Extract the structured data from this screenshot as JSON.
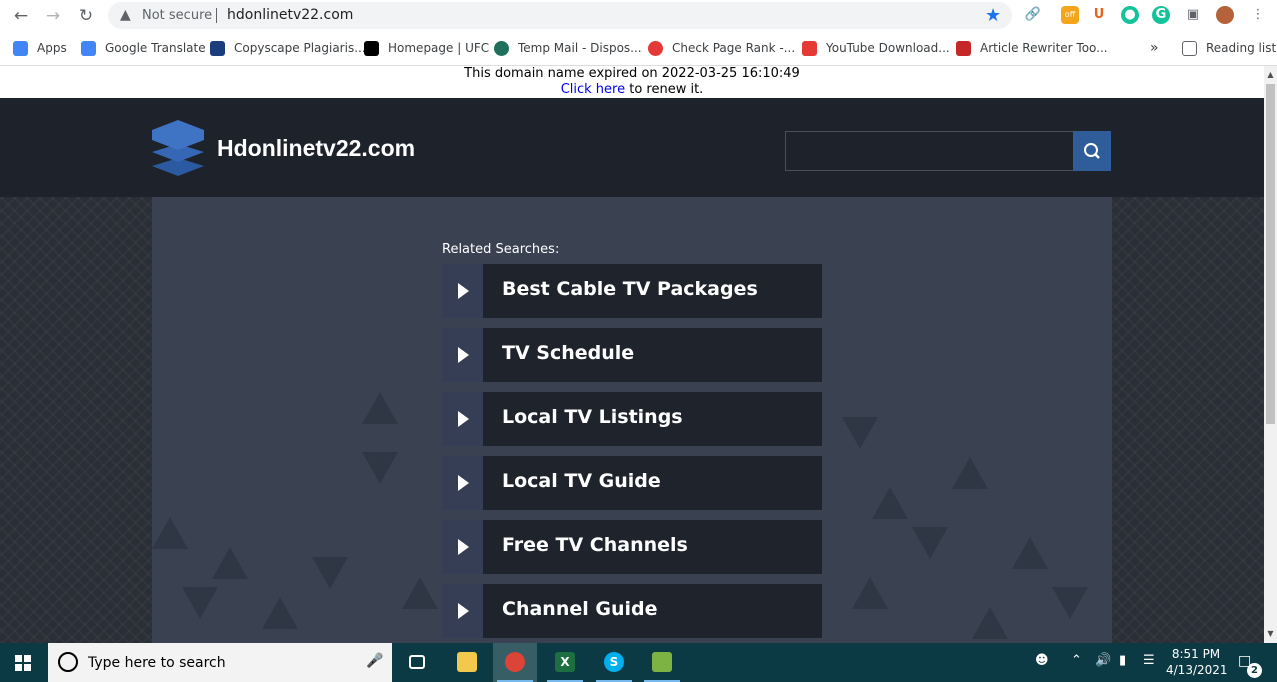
{
  "browser": {
    "security_label": "Not secure",
    "url": "hdonlinetv22.com",
    "bookmarks": [
      {
        "label": "Apps",
        "icon": "apps-grid-icon",
        "color": "#4285f4"
      },
      {
        "label": "Google Translate",
        "icon": "google-translate-icon",
        "color": "#4285f4"
      },
      {
        "label": "Copyscape Plagiaris...",
        "icon": "copyscape-icon",
        "color": "#1a3d7c"
      },
      {
        "label": "Homepage | UFC",
        "icon": "ufc-icon",
        "color": "#000000"
      },
      {
        "label": "Temp Mail - Dispos...",
        "icon": "temp-mail-icon",
        "color": "#1e6f5c"
      },
      {
        "label": "Check Page Rank -...",
        "icon": "page-rank-icon",
        "color": "#e53935"
      },
      {
        "label": "YouTube Download...",
        "icon": "youtube-download-icon",
        "color": "#e53935"
      },
      {
        "label": "Article Rewriter Too...",
        "icon": "article-rewriter-icon",
        "color": "#c62828"
      }
    ],
    "more_bookmarks": "»",
    "reading_list": "Reading list",
    "ext_off_badge": "off",
    "ext_u_label": "U",
    "ext_g_label": "G"
  },
  "notice": {
    "text": "This domain name expired on 2022-03-25 16:10:49",
    "link_text": "Click here",
    "link_suffix": " to renew it."
  },
  "site": {
    "title": "Hdonlinetv22.com",
    "search_placeholder": ""
  },
  "related": {
    "label": "Related Searches:",
    "items": [
      "Best Cable TV Packages",
      "TV Schedule",
      "Local TV Listings",
      "Local TV Guide",
      "Free TV Channels",
      "Channel Guide"
    ]
  },
  "taskbar": {
    "search_text": "Type here to search",
    "time": "8:51 PM",
    "date": "4/13/2021",
    "notification_count": "2",
    "excel_glyph": "X",
    "skype_glyph": "S"
  },
  "colors": {
    "header_bg": "#1e222a",
    "content_bg": "#3a4252",
    "item_bg": "#1f232c",
    "arrow_bg": "#363e55",
    "search_btn": "#2e5d9a",
    "taskbar_bg": "#0c3a44"
  }
}
